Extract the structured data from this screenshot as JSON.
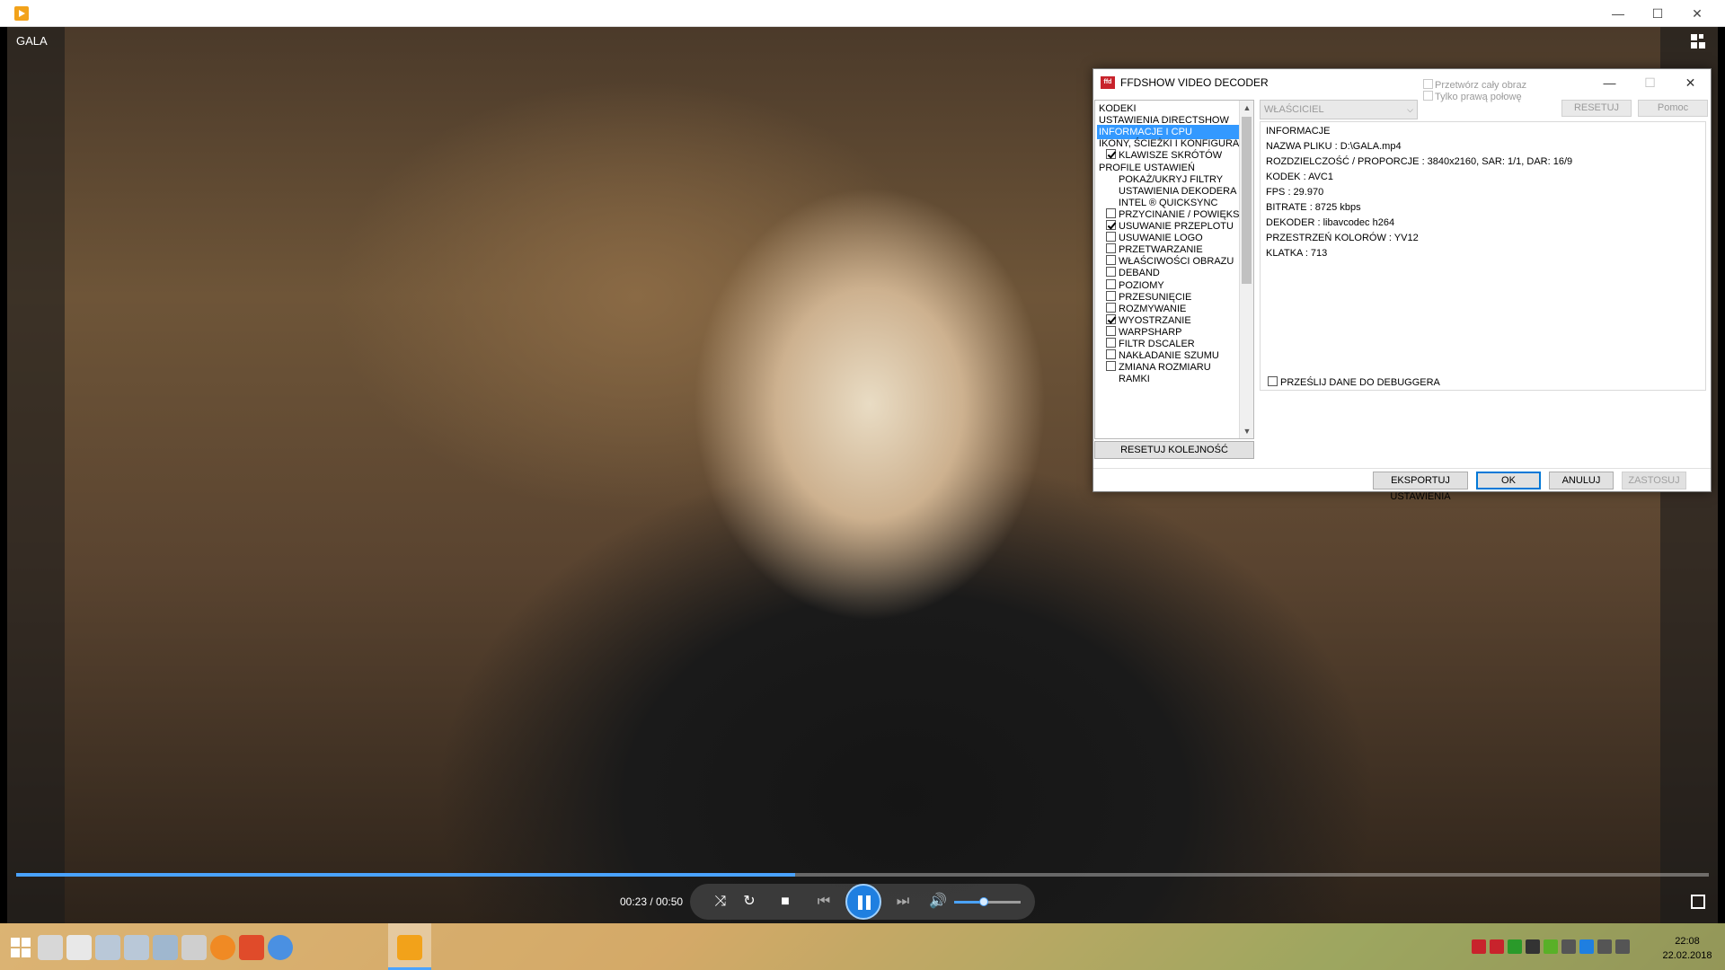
{
  "player": {
    "video_title": "GALA",
    "time": "00:23 / 00:50",
    "progress": 0.46,
    "volume": 0.45,
    "window_buttons": [
      "—",
      "☐",
      "✕"
    ]
  },
  "dialog": {
    "title": "FFDSHOW VIDEO DECODER",
    "icon_text": "ffd",
    "window_buttons": [
      "—",
      "☐",
      "✕"
    ],
    "tree_items": [
      {
        "label": "KODEKI",
        "indent": 0,
        "checkbox": null,
        "selected": false
      },
      {
        "label": "USTAWIENIA DIRECTSHOW",
        "indent": 0,
        "checkbox": null,
        "selected": false
      },
      {
        "label": "INFORMACJE I CPU",
        "indent": 0,
        "checkbox": null,
        "selected": true
      },
      {
        "label": "IKONY, ŚCIEŻKI I KONFIGURAC",
        "indent": 0,
        "checkbox": null,
        "selected": false
      },
      {
        "label": "KLAWISZE SKRÓTÓW",
        "indent": 1,
        "checkbox": true,
        "selected": false
      },
      {
        "label": "PROFILE USTAWIEŃ",
        "indent": 0,
        "checkbox": null,
        "selected": false
      },
      {
        "label": "POKAŻ/UKRYJ FILTRY",
        "indent": 2,
        "checkbox": null,
        "selected": false
      },
      {
        "label": "USTAWIENIA DEKODERA",
        "indent": 2,
        "checkbox": null,
        "selected": false
      },
      {
        "label": "INTEL ® QUICKSYNC",
        "indent": 2,
        "checkbox": null,
        "selected": false
      },
      {
        "label": "PRZYCINANIE / POWIĘKSZ",
        "indent": 1,
        "checkbox": false,
        "selected": false
      },
      {
        "label": "USUWANIE PRZEPLOTU",
        "indent": 1,
        "checkbox": true,
        "selected": false
      },
      {
        "label": "USUWANIE LOGO",
        "indent": 1,
        "checkbox": false,
        "selected": false
      },
      {
        "label": "PRZETWARZANIE",
        "indent": 1,
        "checkbox": false,
        "selected": false
      },
      {
        "label": "WŁAŚCIWOŚCI OBRAZU",
        "indent": 1,
        "checkbox": false,
        "selected": false
      },
      {
        "label": "DEBAND",
        "indent": 1,
        "checkbox": false,
        "selected": false
      },
      {
        "label": "POZIOMY",
        "indent": 1,
        "checkbox": false,
        "selected": false
      },
      {
        "label": "PRZESUNIĘCIE",
        "indent": 1,
        "checkbox": false,
        "selected": false
      },
      {
        "label": "ROZMYWANIE",
        "indent": 1,
        "checkbox": false,
        "selected": false
      },
      {
        "label": "WYOSTRZANIE",
        "indent": 1,
        "checkbox": true,
        "selected": false
      },
      {
        "label": "WARPSHARP",
        "indent": 1,
        "checkbox": false,
        "selected": false
      },
      {
        "label": "FILTR DSCALER",
        "indent": 1,
        "checkbox": false,
        "selected": false
      },
      {
        "label": "NAKŁADANIE SZUMU",
        "indent": 1,
        "checkbox": false,
        "selected": false
      },
      {
        "label": "ZMIANA ROZMIARU",
        "indent": 1,
        "checkbox": false,
        "selected": false
      },
      {
        "label": "RAMKI",
        "indent": 2,
        "checkbox": null,
        "selected": false
      }
    ],
    "reset_order": "RESETUJ KOLEJNOŚĆ",
    "owner_select": "WŁAŚCICIEL",
    "process_whole": "Przetwórz cały obraz",
    "right_half_only": "Tylko prawą połowę",
    "reset_button": "RESETUJ",
    "help_button": "Pomoc",
    "info": [
      "INFORMACJE",
      "NAZWA PLIKU : D:\\GALA.mp4",
      "ROZDZIELCZOŚĆ / PROPORCJE : 3840x2160, SAR: 1/1, DAR: 16/9",
      "KODEK : AVC1",
      "FPS : 29.970",
      "BITRATE : 8725 kbps",
      "DEKODER : libavcodec h264",
      "PRZESTRZEŃ KOLORÓW : YV12",
      "KLATKA : 713"
    ],
    "send_to_debugger": "PRZEŚLIJ DANE DO DEBUGGERA",
    "export_button": "EKSPORTUJ USTAWIENIA",
    "ok_button": "OK",
    "cancel_button": "ANULUJ",
    "apply_button": "ZASTOSUJ"
  },
  "taskbar": {
    "clock_time": "22:08",
    "clock_date": "22.02.2018",
    "pinned_icons": [
      "sd-card-icon",
      "drive-icon",
      "sd-icon",
      "usd-icon",
      "network-drive-icon",
      "removable-drive-icon",
      "firefox-icon",
      "app-icon",
      "chrome-icon",
      "media-player-icon"
    ],
    "tray_icons": [
      "ffdshow-icon",
      "ffdshow-audio-icon",
      "flag-icon",
      "lav-icon",
      "nvidia-icon",
      "network-icon",
      "bluetooth-icon",
      "volume-icon",
      "battery-icon"
    ]
  },
  "colors": {
    "accent": "#1f7fe0",
    "selection": "#3399ff",
    "ffdshow_red": "#c8232c"
  }
}
